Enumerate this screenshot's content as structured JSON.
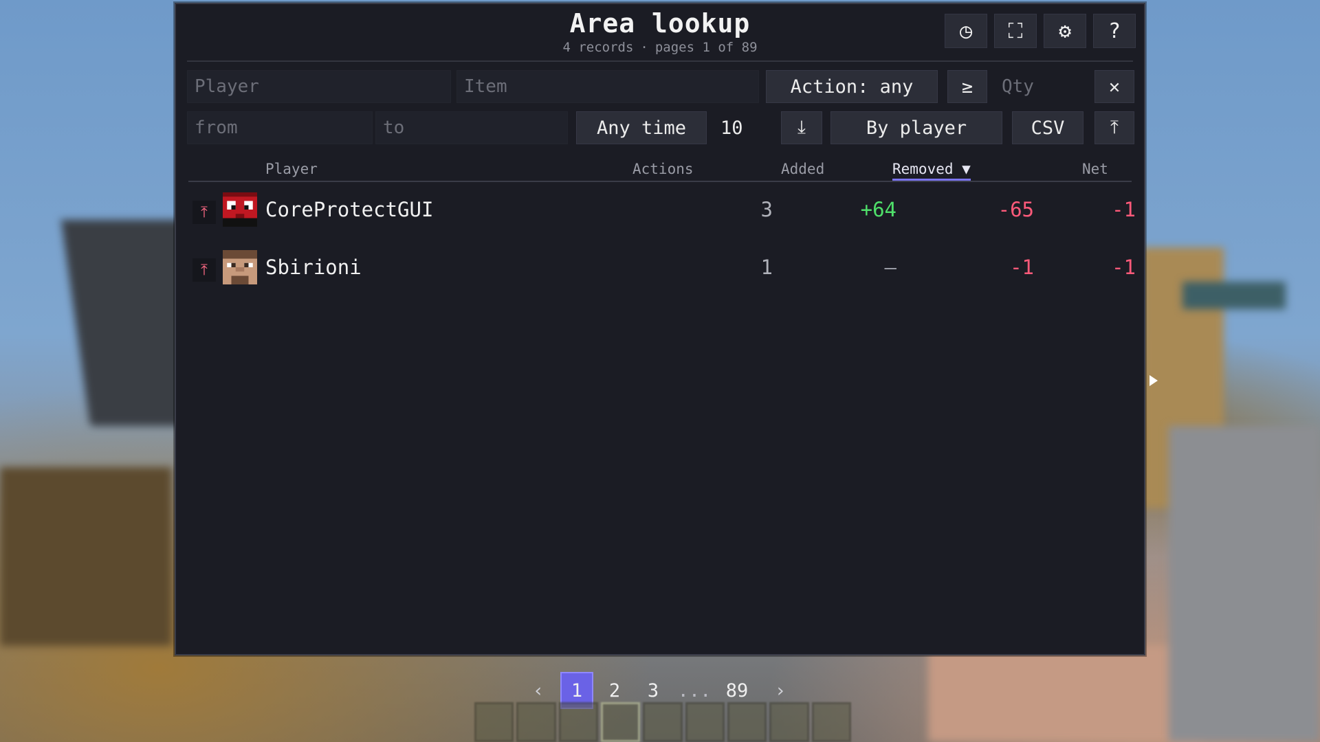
{
  "window": {
    "title": "Area lookup",
    "subtitle_records": "4 records",
    "subtitle_separator": "·",
    "subtitle_pages": "pages 1 of 89",
    "header_icons": [
      {
        "name": "history-icon",
        "glyph": "◷"
      },
      {
        "name": "expand-icon",
        "glyph": "⛶"
      },
      {
        "name": "gear-icon",
        "glyph": "⚙"
      },
      {
        "name": "help-icon",
        "glyph": "?"
      }
    ]
  },
  "filters": {
    "player_placeholder": "Player",
    "item_placeholder": "Item",
    "action_label": "Action: any",
    "comparator_label": "≥",
    "qty_placeholder": "Qty",
    "clear_glyph": "✕",
    "from_placeholder": "from",
    "to_placeholder": "to",
    "time_label": "Any time",
    "limit_value": "10",
    "download_glyph": "⤓",
    "group_label": "By player",
    "csv_label": "CSV",
    "upload_glyph": "⤒"
  },
  "table": {
    "headers": {
      "player": "Player",
      "actions": "Actions",
      "added": "Added",
      "removed": "Removed ▼",
      "net": "Net"
    },
    "sorted_column": "removed",
    "rows": [
      {
        "player": "CoreProtectGUI",
        "actions": "3",
        "added": "+64",
        "removed": "-65",
        "net": "-1",
        "teleport_glyph": "⤒"
      },
      {
        "player": "Sbirioni",
        "actions": "1",
        "added": "—",
        "removed": "-1",
        "net": "-1",
        "teleport_glyph": "⤒"
      }
    ]
  },
  "pagination": {
    "prev": "‹",
    "pages": [
      "1",
      "2",
      "3"
    ],
    "ellipsis": "...",
    "last": "89",
    "next": "›",
    "current": "1"
  },
  "colors": {
    "accent": "#6a62e6",
    "positive": "#4fe06a",
    "negative": "#ff5a7a",
    "panel_bg": "#1b1c24"
  }
}
